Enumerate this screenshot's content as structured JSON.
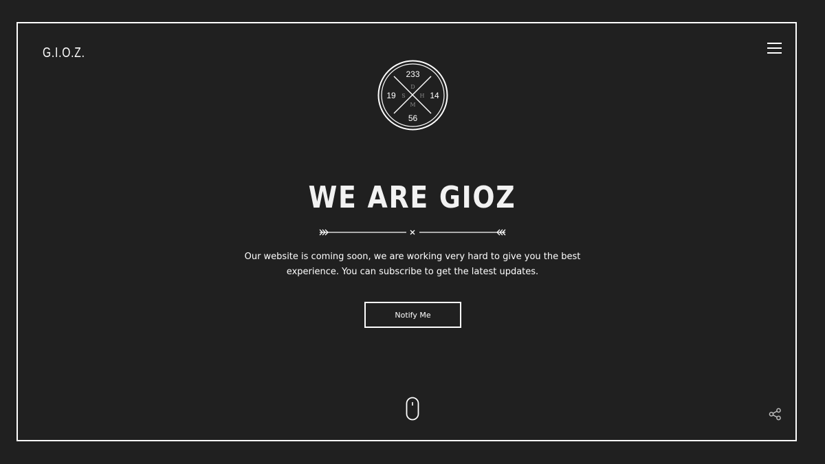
{
  "brand": {
    "logo_text": "G.I.O.Z."
  },
  "header": {
    "menu_icon": "hamburger-menu-icon"
  },
  "badge": {
    "top_number": "233",
    "left_number": "19",
    "right_number": "14",
    "bottom_number": "56",
    "letter_top": "D",
    "letter_left": "S",
    "letter_right": "H",
    "letter_bottom": "M"
  },
  "hero": {
    "title": "WE ARE GIOZ",
    "divider_icon": "arrow-divider-icon",
    "description_line1": "Our website is coming soon, we are working very hard to give you the best",
    "description_line2": "experience. You can subscribe to get the latest updates.",
    "cta_label": "Notify Me"
  },
  "footer": {
    "scroll_icon": "mouse-scroll-icon",
    "share_icon": "share-icon"
  },
  "colors": {
    "background": "#202020",
    "foreground": "#ffffff",
    "muted": "#8a8a8a"
  }
}
